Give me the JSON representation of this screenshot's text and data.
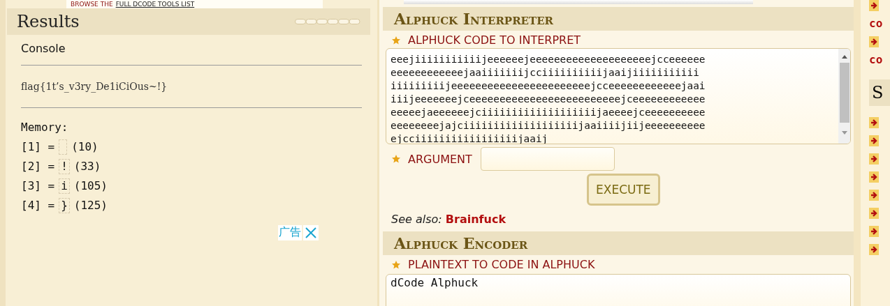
{
  "top_link": {
    "prefix": "BROWSE THE",
    "link": "FULL DCODE TOOLS LIST"
  },
  "results": {
    "title": "Results",
    "console_label": "Console",
    "output": "flag{1t’s_v3ry_De1iCiOus~!}",
    "memory_label": "Memory:",
    "memory": [
      {
        "index": "[1] =",
        "code": "(10)"
      },
      {
        "index": "[2] =",
        "char": "!",
        "code": "(33)"
      },
      {
        "index": "[3] =",
        "char": "i",
        "code": "(105)"
      },
      {
        "index": "[4] =",
        "char": "}",
        "code": "(125)"
      }
    ],
    "ad": {
      "label": "广告"
    }
  },
  "interpreter": {
    "title": "Alphuck Interpreter",
    "code_label": "ALPHUCK CODE TO INTERPRET",
    "code_lines": [
      "eeejiiiiiiiiiiijeeeeeejeeeeeeeeeeeeeeeeeeeejcceeeeee",
      "eeeeeeeeeeeejaaiiiiiiijcciiiiiiiiiijaaijiiiiiiiiiii",
      "iiiiiiiiijeeeeeeeeeeeeeeeeeeeeeeejcceeeeeeeeeeeejaai",
      "iiijeeeeeeejceeeeeeeeeeeeeeeeeeeeeeeeejceeeeeeeeeeee",
      "eeeeejaeeeeeejciiiiiiiiiiiiiiiiiiijaeeeejceeeeeeeeee",
      "eeeeeeeejajciiiiiiiiiiiiiiiiiiijaaiiiijiijeeeeeeeeee",
      "ejcciiiiiiiiiiiiiiiiijaaij"
    ],
    "argument_label": "ARGUMENT",
    "execute": "EXECUTE",
    "see_also": "See also:",
    "see_also_link": "Brainfuck"
  },
  "encoder": {
    "title": "Alphuck Encoder",
    "plaintext_label": "PLAINTEXT TO CODE IN ALPHUCK",
    "plaintext": "dCode Alphuck"
  },
  "right_column": {
    "links": [
      "co",
      "co"
    ],
    "heading": "S"
  }
}
